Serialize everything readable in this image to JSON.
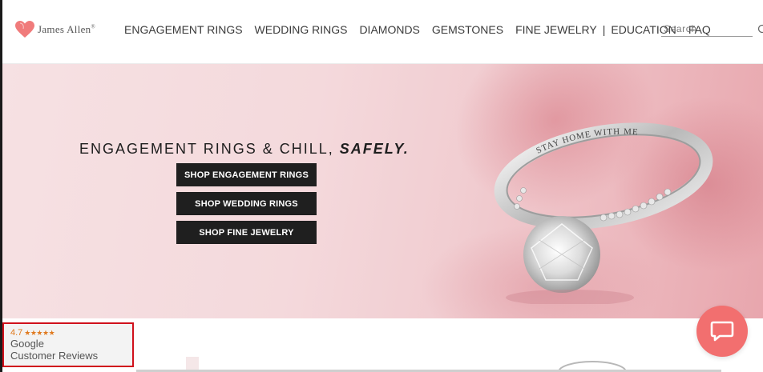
{
  "brand": {
    "name": "James Allen",
    "registered_mark": "®",
    "accent_color": "#f26f6f"
  },
  "nav": {
    "items": [
      {
        "label": "ENGAGEMENT RINGS"
      },
      {
        "label": "WEDDING RINGS"
      },
      {
        "label": "DIAMONDS"
      },
      {
        "label": "GEMSTONES"
      },
      {
        "label": "FINE JEWELRY"
      },
      {
        "label": "EDUCATION"
      },
      {
        "label": "FAQ"
      }
    ],
    "separator": "|"
  },
  "search": {
    "placeholder": "Search",
    "value": ""
  },
  "hero": {
    "headline_prefix": "ENGAGEMENT RINGS & CHILL, ",
    "headline_emphasis": "SAFELY.",
    "ring_engraving": "STAY HOME WITH ME",
    "buttons": [
      {
        "label": "SHOP ENGAGEMENT RINGS"
      },
      {
        "label": "SHOP WEDDING RINGS"
      },
      {
        "label": "SHOP FINE JEWELRY"
      }
    ]
  },
  "review_badge": {
    "rating": "4.7",
    "stars": "★★★★★",
    "line1": "Google",
    "line2": "Customer Reviews",
    "star_color": "#e07a1f",
    "highlight_color": "#d0101c"
  },
  "chat": {
    "icon": "chat-bubble-icon",
    "color": "#f26f6f"
  }
}
